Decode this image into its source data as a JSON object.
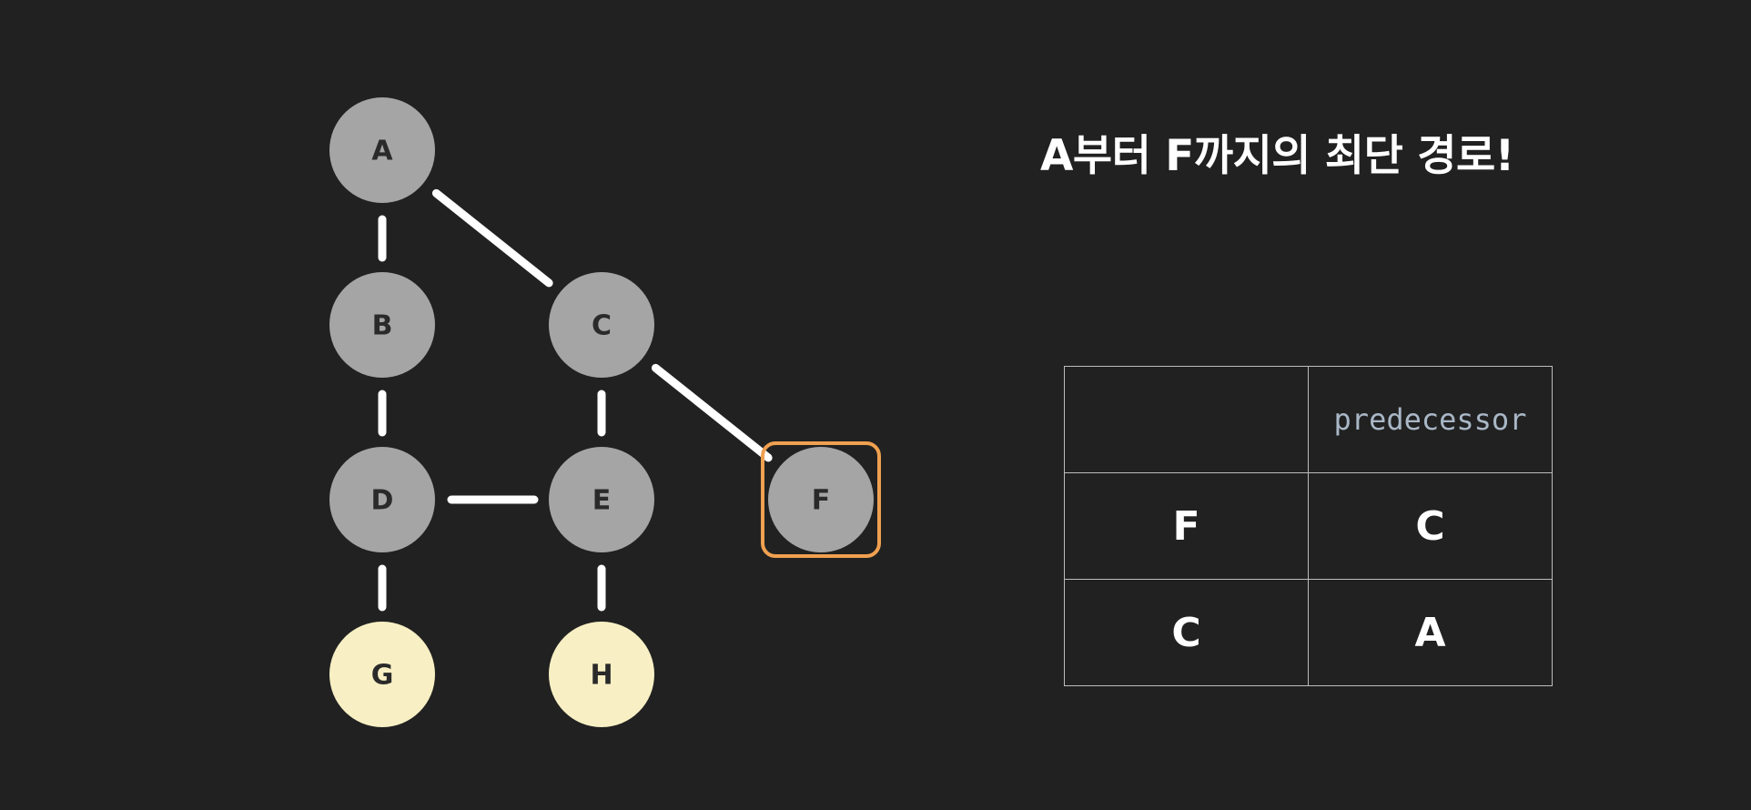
{
  "title": "A부터 F까지의 최단 경로!",
  "graph": {
    "nodes": [
      {
        "id": "A",
        "label": "A",
        "color": "#a5a5a5"
      },
      {
        "id": "B",
        "label": "B",
        "color": "#a5a5a5"
      },
      {
        "id": "C",
        "label": "C",
        "color": "#a5a5a5"
      },
      {
        "id": "D",
        "label": "D",
        "color": "#a5a5a5"
      },
      {
        "id": "E",
        "label": "E",
        "color": "#a5a5a5"
      },
      {
        "id": "F",
        "label": "F",
        "color": "#a5a5a5",
        "highlighted": true
      },
      {
        "id": "G",
        "label": "G",
        "color": "#f8f0c4"
      },
      {
        "id": "H",
        "label": "H",
        "color": "#f8f0c4"
      }
    ],
    "edges": [
      {
        "from": "A",
        "to": "B"
      },
      {
        "from": "A",
        "to": "C"
      },
      {
        "from": "B",
        "to": "D"
      },
      {
        "from": "C",
        "to": "E"
      },
      {
        "from": "C",
        "to": "F"
      },
      {
        "from": "D",
        "to": "E"
      },
      {
        "from": "D",
        "to": "G"
      },
      {
        "from": "E",
        "to": "H"
      }
    ],
    "edge_color": "#ffffff",
    "highlight_color": "#f0a050"
  },
  "table": {
    "header": [
      "",
      "predecessor"
    ],
    "rows": [
      [
        "F",
        "C"
      ],
      [
        "C",
        "A"
      ]
    ]
  },
  "colors": {
    "background": "#212121",
    "text": "#ffffff",
    "header_text": "#a9b7c6",
    "table_border": "#bdbdbd"
  }
}
